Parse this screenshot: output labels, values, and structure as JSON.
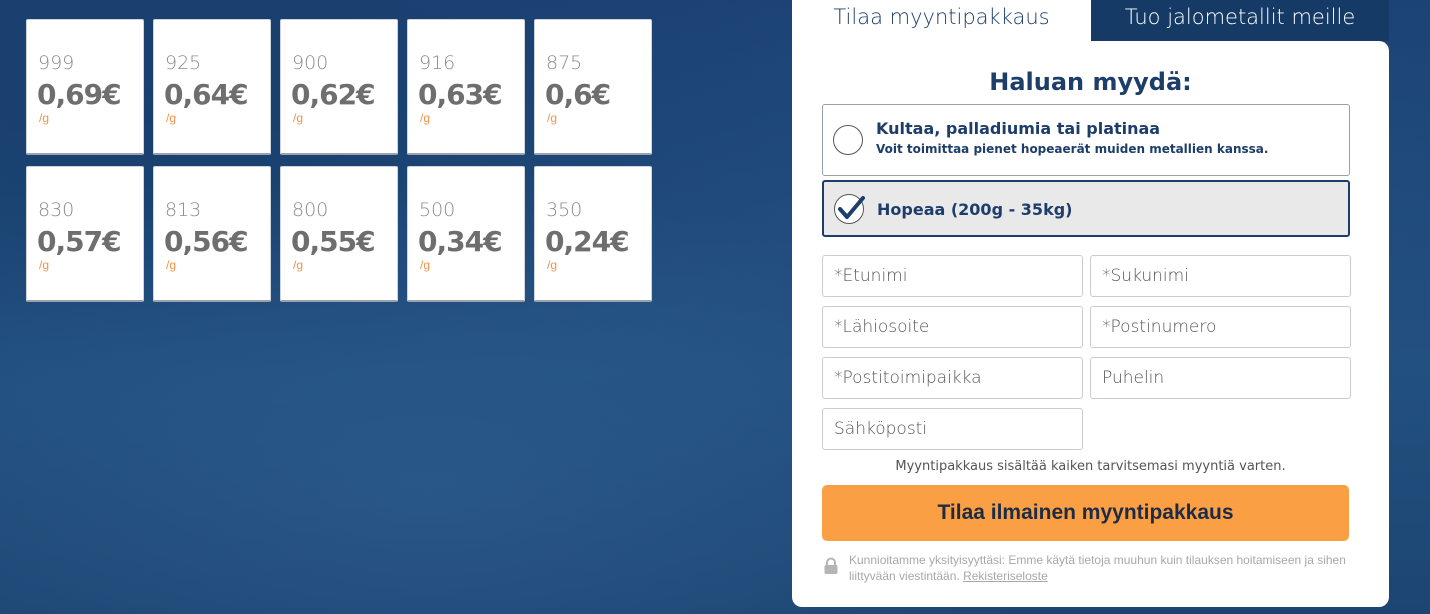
{
  "tiles": [
    {
      "fineness": "999",
      "price": "0,69€",
      "unit": "/g"
    },
    {
      "fineness": "925",
      "price": "0,64€",
      "unit": "/g"
    },
    {
      "fineness": "900",
      "price": "0,62€",
      "unit": "/g"
    },
    {
      "fineness": "916",
      "price": "0,63€",
      "unit": "/g"
    },
    {
      "fineness": "875",
      "price": "0,6€",
      "unit": "/g"
    },
    {
      "fineness": "830",
      "price": "0,57€",
      "unit": "/g"
    },
    {
      "fineness": "813",
      "price": "0,56€",
      "unit": "/g"
    },
    {
      "fineness": "800",
      "price": "0,55€",
      "unit": "/g"
    },
    {
      "fineness": "500",
      "price": "0,34€",
      "unit": "/g"
    },
    {
      "fineness": "350",
      "price": "0,24€",
      "unit": "/g"
    }
  ],
  "tabs": {
    "active": "Tilaa myyntipakkaus",
    "inactive": "Tuo jalometallit meille"
  },
  "form": {
    "title": "Haluan myydä:",
    "option1": {
      "label": "Kultaa, palladiumia tai platinaa",
      "sub": "Voit toimittaa pienet hopeaerät muiden metallien kanssa.",
      "selected": false
    },
    "option2": {
      "label": "Hopeaa (200g - 35kg)",
      "selected": true
    },
    "fields": {
      "first_name": "*Etunimi",
      "last_name": "*Sukunimi",
      "address": "*Lähiosoite",
      "postal_code": "*Postinumero",
      "city": "*Postitoimipaikka",
      "phone": "Puhelin",
      "email": "Sähköposti"
    },
    "info": "Myyntipakkaus sisältää kaiken tarvitsemasi myyntiä varten.",
    "submit": "Tilaa ilmainen myyntipakkaus",
    "privacy_text": "Kunnioitamme yksityisyyttäsi: Emme käytä tietoja muuhun kuin tilauksen hoitamiseen ja sihen liittyvään viestintään.",
    "privacy_link": "Rekisteriseloste"
  },
  "colors": {
    "brand_navy": "#1d3d6a",
    "accent_orange": "#fb9f45",
    "background_blue": "#1d4675"
  }
}
